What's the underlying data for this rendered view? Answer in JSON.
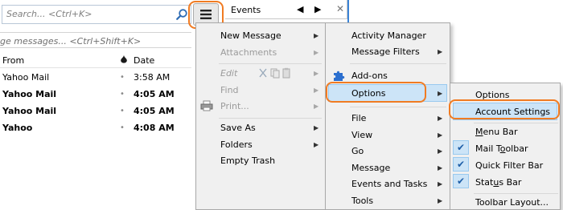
{
  "search": {
    "placeholder": "Search... <Ctrl+K>"
  },
  "filter": {
    "placeholder": "ge messages... <Ctrl+Shift+K>"
  },
  "message_list": {
    "columns": {
      "from": "From",
      "date": "Date"
    },
    "rows": [
      {
        "from": "Yahoo Mail",
        "date": "3:58 AM",
        "unread": false
      },
      {
        "from": "Yahoo Mail",
        "date": "4:05 AM",
        "unread": true
      },
      {
        "from": "Yahoo Mail",
        "date": "4:05 AM",
        "unread": true
      },
      {
        "from": "Yahoo",
        "date": "4:08 AM",
        "unread": true
      }
    ],
    "row_dot": "•"
  },
  "tab": {
    "label": "Events",
    "prev": "◀",
    "next": "▶",
    "close": "✕"
  },
  "main_menu": {
    "new_message": "New Message",
    "attachments": "Attachments",
    "edit": "Edit",
    "find": "Find",
    "print": "Print...",
    "save_as": "Save As",
    "folders": "Folders",
    "empty_trash": "Empty Trash"
  },
  "tools_menu": {
    "activity_manager": "Activity Manager",
    "message_filters": "Message Filters",
    "addons": "Add-ons",
    "options": "Options",
    "file": "File",
    "view": "View",
    "go": "Go",
    "message": "Message",
    "events_and_tasks": "Events and Tasks",
    "tools": "Tools"
  },
  "options_menu": {
    "options": "Options",
    "account_settings": "Account Settings",
    "menu_bar": {
      "u": "M",
      "rest": "enu Bar"
    },
    "mail_toolbar": {
      "pre": "Mail T",
      "u": "o",
      "rest": "olbar"
    },
    "quick_filter_bar": "Quick Filter Bar",
    "status_bar": {
      "pre": "Stat",
      "u": "u",
      "rest": "s Bar"
    },
    "toolbar_layout": "Toolbar Layout..."
  },
  "checks": {
    "mail_toolbar": true,
    "quick_filter_bar": true,
    "status_bar": true
  },
  "symbols": {
    "submenu_arrow": "▶",
    "check": "✔"
  },
  "colors": {
    "highlight_ring": "#f07b22",
    "menu_highlight": "#cce4f7",
    "menu_bg": "#f0f0f0",
    "check_blue": "#1f5fa8"
  }
}
